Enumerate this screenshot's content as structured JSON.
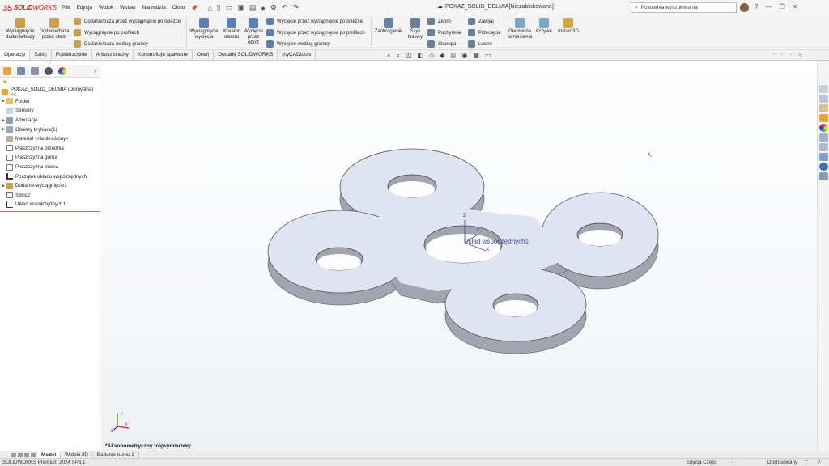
{
  "app": {
    "brand_prefix": "3S",
    "brand_bold": "SOLID",
    "brand_rest": "WORKS"
  },
  "menu": [
    "Plik",
    "Edycja",
    "Widok",
    "Wstaw",
    "Narzędzia",
    "Okno"
  ],
  "document_title": "POKAZ_SOLID_DELMIA[Niezablokowane]",
  "search": {
    "placeholder": "Polecenia wyszukiwania"
  },
  "ribbon": {
    "extrude_boss": "Wyciągnięcie dodania/bazy",
    "revolve_boss": "Dodanie/baza przez obrót",
    "sweep_boss": "Dodanie/baza przez wyciągnięcie po ścieżce",
    "loft_boss": "Wyciągnięcie po profilach",
    "boundary_boss": "Dodanie/baza według granicy",
    "extrude_cut": "Wyciągnięcie wycięcia",
    "hole_wizard": "Kreator otworu",
    "revolve_cut": "Wycięcie przez obrót",
    "sweep_cut": "Wycięcie przez wyciągnięcie po ścieżce",
    "loft_cut": "Wycięcie przez wyciągnięcie po profilach",
    "boundary_cut": "Wycięcie według granicy",
    "fillet": "Zaokrąglenie",
    "linear_pattern": "Szyk liniowy",
    "rib": "Żebro",
    "draft": "Pochylenie",
    "shell": "Skorupa",
    "wrap": "Zawijaj",
    "intersect": "Przecięcie",
    "mirror": "Lustro",
    "reference_geometry": "Geometria odniesienia",
    "curves": "Krzywe",
    "instant3d": "Instant3D"
  },
  "command_tabs": [
    "Operacje",
    "Szkic",
    "Powierzchnie",
    "Arkusz blachy",
    "Konstrukcje spawane",
    "Oceń",
    "Dodatki SOLIDWORKS",
    "myCADtools"
  ],
  "active_command_tab": "Operacje",
  "feature_tree": {
    "root": "POKAZ_SOLID_DELMIA (Domyślna) <<",
    "items": [
      {
        "label": "Folder",
        "expand": "▶"
      },
      {
        "label": "Sensory",
        "expand": ""
      },
      {
        "label": "Adnotacje",
        "expand": "▶"
      },
      {
        "label": "Obiekty bryłowe(1)",
        "expand": "▶"
      },
      {
        "label": "Materiał <nieokreślony>",
        "expand": ""
      },
      {
        "label": "Płaszczyzna przednia",
        "expand": ""
      },
      {
        "label": "Płaszczyzna górna",
        "expand": ""
      },
      {
        "label": "Płaszczyzna prawa",
        "expand": ""
      },
      {
        "label": "Początek układu współrzędnych",
        "expand": ""
      },
      {
        "label": "Dodanie-wyciągnięcie1",
        "expand": "▶"
      },
      {
        "label": "Szkic2",
        "expand": ""
      },
      {
        "label": "Układ współrzędnych1",
        "expand": ""
      }
    ]
  },
  "viewport": {
    "coord_system_label": "Układ współrzędnych1",
    "view_orientation": "*Aksonometryczny trójwymiarowy",
    "triad_axes": {
      "x": "X",
      "y": "Y",
      "z": "Z"
    }
  },
  "bottom_tabs": [
    "Model",
    "Widoki 3D",
    "Badanie ruchu 1"
  ],
  "active_bottom_tab": "Model",
  "status": {
    "version": "SOLIDWORKS Premium 2024 SP3.1",
    "mode": "Edycja Część",
    "customize": "Dostosowany"
  },
  "colors": {
    "part_face": "#e0e3f2",
    "part_side": "#a2a4af",
    "brand_red": "#d22222",
    "accent_blue": "#4a90d9"
  }
}
